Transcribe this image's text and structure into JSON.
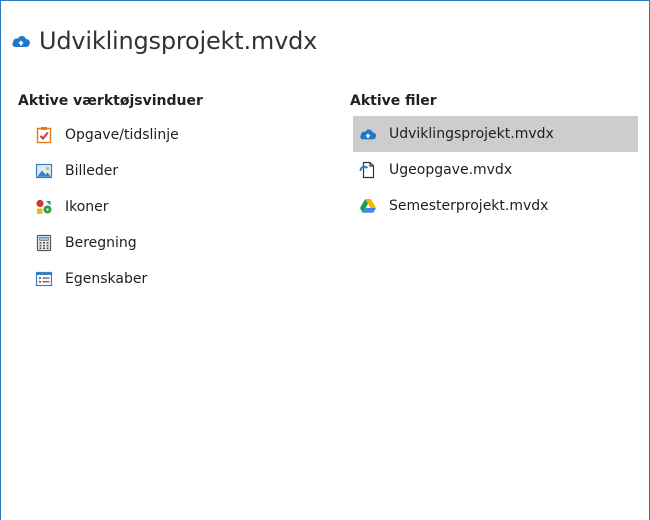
{
  "window": {
    "title": "Udviklingsprojekt.mvdx",
    "title_icon": "cloud-icon",
    "border_color": "#2b79c2"
  },
  "tool_windows": {
    "heading": "Aktive værktøjsvinduer",
    "items": [
      {
        "label": "Opgave/tidslinje",
        "icon": "task-clipboard-icon"
      },
      {
        "label": "Billeder",
        "icon": "image-icon"
      },
      {
        "label": "Ikoner",
        "icon": "icons-palette-icon"
      },
      {
        "label": "Beregning",
        "icon": "calculator-icon"
      },
      {
        "label": "Egenskaber",
        "icon": "properties-list-icon"
      }
    ]
  },
  "active_files": {
    "heading": "Aktive filer",
    "selected_color": "#cdcdcd",
    "items": [
      {
        "label": "Udviklingsprojekt.mvdx",
        "icon": "cloud-icon",
        "selected": true
      },
      {
        "label": "Ugeopgave.mvdx",
        "icon": "document-icon",
        "selected": false
      },
      {
        "label": "Semesterprojekt.mvdx",
        "icon": "google-drive-icon",
        "selected": false
      }
    ]
  }
}
